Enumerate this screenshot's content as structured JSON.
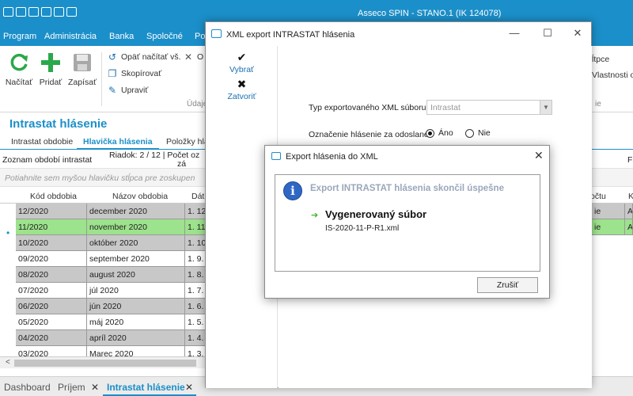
{
  "app": {
    "title": "Asseco SPIN   -   STANO.1 (IK 124078)",
    "menu": [
      "Program",
      "Administrácia",
      "Banka",
      "Spoločné",
      "Po"
    ]
  },
  "ribbon": {
    "reload_label": "Načítať",
    "add_label": "Pridať",
    "save_label": "Zapísať",
    "reload_all_label": "Opäť načítať vš.",
    "close_partial": "O",
    "copy_label": "Skopírovať",
    "edit_label": "Upraviť",
    "group_data_partial": "Údaje",
    "right_partial_1": "ĺtpce",
    "right_partial_2": "Vlastnosti ok",
    "group_right_partial": "ie"
  },
  "section": {
    "title": "Intrastat hlásenie",
    "subtabs": [
      "Intrastat obdobie",
      "Hlavička hlásenia",
      "Položky hlás"
    ],
    "list_title": "Zoznam období intrastat",
    "row_info": "Riadok: 2 / 12 | Počet oz",
    "row_info_2": "zá",
    "right_fragment": "F",
    "group_hint": "Potiahnite sem myšou hlavičku stĺpca pre zoskupen"
  },
  "grid": {
    "headers": [
      "Kód obdobia",
      "Názov obdobia",
      "Dát"
    ],
    "right_headers": [
      "očtu",
      "K"
    ],
    "rows": [
      {
        "code": "12/2020",
        "name": "december 2020",
        "date": "1. 12",
        "r1": "ie",
        "r2": "A"
      },
      {
        "code": "11/2020",
        "name": "november 2020",
        "date": "1. 11",
        "r1": "ie",
        "r2": "A"
      },
      {
        "code": "10/2020",
        "name": "október 2020",
        "date": "1. 10"
      },
      {
        "code": "09/2020",
        "name": "september 2020",
        "date": "1. 9."
      },
      {
        "code": "08/2020",
        "name": "august 2020",
        "date": "1. 8."
      },
      {
        "code": "07/2020",
        "name": "júl 2020",
        "date": "1. 7."
      },
      {
        "code": "06/2020",
        "name": "jún 2020",
        "date": "1. 6."
      },
      {
        "code": "05/2020",
        "name": "máj 2020",
        "date": "1. 5."
      },
      {
        "code": "04/2020",
        "name": "apríl 2020",
        "date": "1. 4."
      },
      {
        "code": "03/2020",
        "name": "Marec 2020",
        "date": "1. 3."
      }
    ]
  },
  "bottom_tabs": [
    "Dashboard",
    "Príjem",
    "Intrastat hlásenie"
  ],
  "xml_window": {
    "title": "XML export INTRASTAT hlásenia",
    "select_label": "Vybrať",
    "close_label": "Zatvoriť",
    "type_label": "Typ exportovaného XML súboru",
    "type_value": "Intrastat",
    "mark_label": "Označenie hlásenie za odoslané",
    "yes_label": "Áno",
    "no_label": "Nie"
  },
  "dialog": {
    "title": "Export hlásenia do XML",
    "heading": "Export INTRASTAT hlásenia skončil úspešne",
    "subheading": "Vygenerovaný súbor",
    "filename": "IS-2020-11-P-R1.xml",
    "cancel_label": "Zrušiť"
  },
  "icons": {
    "reload": "refresh-icon",
    "add": "plus-icon",
    "save": "floppy-icon",
    "info": "info-icon",
    "success": "arrow-right-icon"
  }
}
